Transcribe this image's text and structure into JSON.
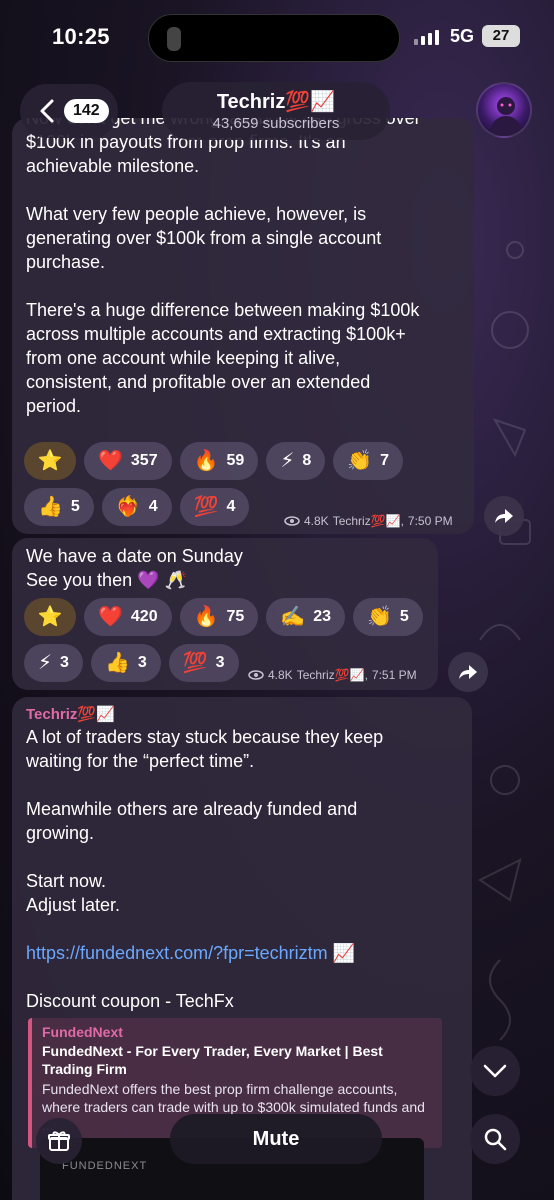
{
  "status_bar": {
    "time": "10:25",
    "network": "5G",
    "battery": "27"
  },
  "header": {
    "back_count": "142",
    "channel_name": "Techriz💯📈",
    "subscribers": "43,659 subscribers"
  },
  "messages": [
    {
      "text": "Now don't get me wrong, anybody can gross over\n$100k in payouts from prop firms. It's an\nachievable milestone.\n\nWhat very few people achieve, however, is\ngenerating over $100k from a single account\npurchase.\n\nThere's a huge difference between making $100k\nacross multiple accounts and extracting $100k+\nfrom one account while keeping it alive,\nconsistent, and profitable over an extended\nperiod.",
      "reactions": [
        {
          "emoji": "⭐",
          "count": ""
        },
        {
          "emoji": "❤️",
          "count": "357"
        },
        {
          "emoji": "🔥",
          "count": "59"
        },
        {
          "emoji": "⚡",
          "count": "8"
        },
        {
          "emoji": "👏",
          "count": "7"
        },
        {
          "emoji": "👍",
          "count": "5"
        },
        {
          "emoji": "❤️‍🔥",
          "count": "4"
        },
        {
          "emoji": "💯",
          "count": "4"
        }
      ],
      "views": "4.8K",
      "author": "Techriz💯📈,",
      "time": "7:50 PM"
    },
    {
      "text": "We have a date on Sunday\nSee you then 💜 🥂",
      "reactions": [
        {
          "emoji": "⭐",
          "count": ""
        },
        {
          "emoji": "❤️",
          "count": "420"
        },
        {
          "emoji": "🔥",
          "count": "75"
        },
        {
          "emoji": "✍️",
          "count": "23"
        },
        {
          "emoji": "👏",
          "count": "5"
        },
        {
          "emoji": "⚡",
          "count": "3"
        },
        {
          "emoji": "👍",
          "count": "3"
        },
        {
          "emoji": "💯",
          "count": "3"
        }
      ],
      "views": "4.8K",
      "author": "Techriz💯📈,",
      "time": "7:51 PM"
    },
    {
      "sender": "Techriz💯📈",
      "text_1": "A lot of traders stay stuck because they keep\nwaiting for the “perfect time”.\n\nMeanwhile others are already funded and\ngrowing.\n\nStart now.\nAdjust later.",
      "link": "https://fundednext.com/?fpr=techriztm",
      "link_suffix": " 📈",
      "text_2": "Discount coupon - TechFx",
      "preview": {
        "site": "FundedNext",
        "title": "FundedNext - For Every Trader, Every Market | Best Trading Firm",
        "description": "FundedNext offers the best prop firm challenge accounts, where traders can trade with up to $300k simulated funds and ..."
      },
      "preview_logo": "FUNDEDNEXT"
    }
  ],
  "bottom": {
    "mute_label": "Mute"
  }
}
